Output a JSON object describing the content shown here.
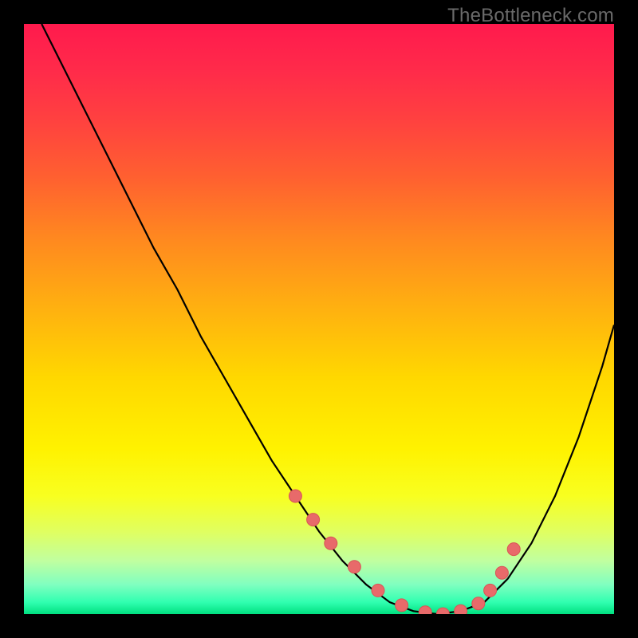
{
  "watermark": "TheBottleneck.com",
  "colors": {
    "background": "#000000",
    "curve": "#000000",
    "marker_fill": "#e86a6a",
    "marker_stroke": "#d95555"
  },
  "chart_data": {
    "type": "line",
    "title": "",
    "xlabel": "",
    "ylabel": "",
    "xlim": [
      0,
      100
    ],
    "ylim": [
      0,
      100
    ],
    "grid": false,
    "series": [
      {
        "name": "curve",
        "x": [
          3,
          6,
          10,
          14,
          18,
          22,
          26,
          30,
          34,
          38,
          42,
          46,
          50,
          54,
          58,
          62,
          66,
          70,
          74,
          78,
          82,
          86,
          90,
          94,
          98,
          100
        ],
        "y": [
          100,
          94,
          86,
          78,
          70,
          62,
          55,
          47,
          40,
          33,
          26,
          20,
          14,
          9,
          5,
          2,
          0.5,
          0,
          0.5,
          2,
          6,
          12,
          20,
          30,
          42,
          49
        ]
      }
    ],
    "markers": {
      "name": "highlighted-points",
      "x": [
        46,
        49,
        52,
        56,
        60,
        64,
        68,
        71,
        74,
        77,
        79,
        81,
        83
      ],
      "y": [
        20,
        16,
        12,
        8,
        4,
        1.5,
        0.3,
        0,
        0.5,
        1.8,
        4,
        7,
        11
      ]
    }
  }
}
